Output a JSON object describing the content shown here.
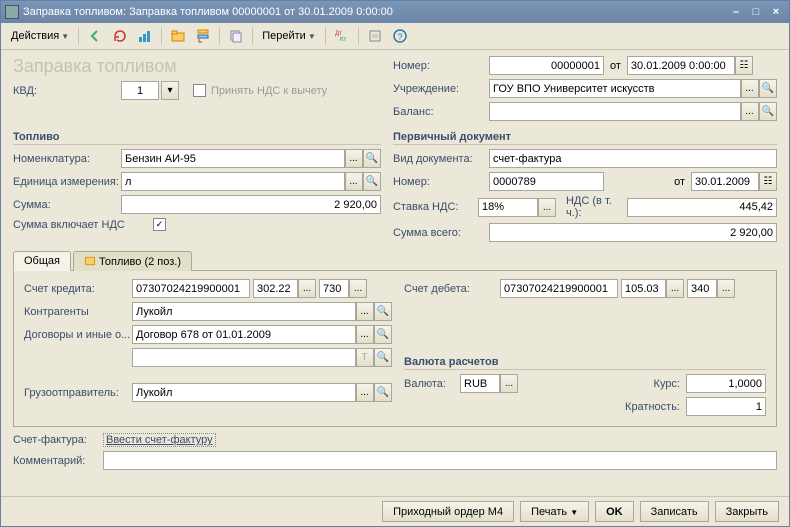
{
  "window": {
    "title": "Заправка топливом: Заправка топливом 00000001 от 30.01.2009 0:00:00"
  },
  "toolbar": {
    "actions": "Действия",
    "goto": "Перейти"
  },
  "formTitle": "Заправка топливом",
  "header": {
    "number_lbl": "Номер:",
    "number": "00000001",
    "ot": "от",
    "date": "30.01.2009 0:00:00",
    "kvd_lbl": "КВД:",
    "kvd": "1",
    "vat_chk_lbl": "Принять НДС к вычету",
    "org_lbl": "Учреждение:",
    "org": "ГОУ ВПО Университет искусств",
    "balance_lbl": "Баланс:",
    "balance": ""
  },
  "fuel": {
    "hdr": "Топливо",
    "nomen_lbl": "Номенклатура:",
    "nomen": "Бензин АИ-95",
    "uom_lbl": "Единица измерения:",
    "uom": "л",
    "sum_lbl": "Сумма:",
    "sum": "2 920,00",
    "sum_incl_lbl": "Сумма включает НДС"
  },
  "pdoc": {
    "hdr": "Первичный документ",
    "kind_lbl": "Вид документа:",
    "kind": "счет-фактура",
    "num_lbl": "Номер:",
    "num": "0000789",
    "ot": "от",
    "date": "30.01.2009",
    "vatrate_lbl": "Ставка НДС:",
    "vatrate": "18%",
    "vat_incl_lbl": "НДС (в т. ч.):",
    "vat": "445,42",
    "total_lbl": "Сумма всего:",
    "total": "2 920,00"
  },
  "tabs": {
    "t1": "Общая",
    "t2": "Топливо (2 поз.)"
  },
  "acct": {
    "cr_lbl": "Счет кредита:",
    "cr1": "07307024219900001",
    "cr2": "302.22",
    "cr3": "730",
    "db_lbl": "Счет дебета:",
    "db1": "07307024219900001",
    "db2": "105.03",
    "db3": "340",
    "ctr_lbl": "Контрагенты",
    "ctr": "Лукойл",
    "dog_lbl": "Договоры и иные о...",
    "dog": "Договор 678 от 01.01.2009",
    "t_btn": "T",
    "ship_lbl": "Грузоотправитель:",
    "ship": "Лукойл"
  },
  "currency": {
    "hdr": "Валюта расчетов",
    "cur_lbl": "Валюта:",
    "cur": "RUB",
    "rate_lbl": "Курс:",
    "rate": "1,0000",
    "mult_lbl": "Кратность:",
    "mult": "1"
  },
  "footer": {
    "sf_lbl": "Счет-фактура:",
    "sf_link": "Ввести счет-фактуру",
    "comment_lbl": "Комментарий:",
    "comment": ""
  },
  "buttons": {
    "m4": "Приходный ордер М4",
    "print": "Печать",
    "ok": "OK",
    "write": "Записать",
    "close": "Закрыть"
  }
}
